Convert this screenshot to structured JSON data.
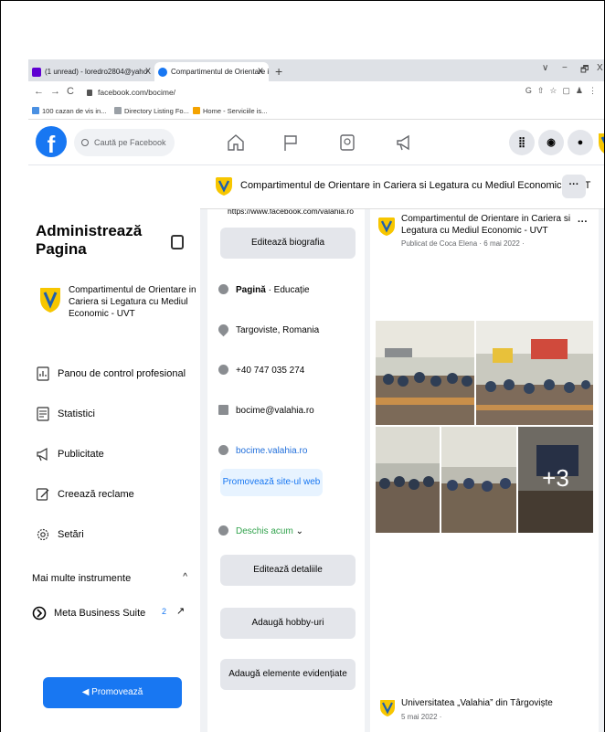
{
  "browser": {
    "tabs": [
      {
        "label": "(1 unread) - loredro2804@yaho",
        "close": "X"
      },
      {
        "label": "Compartimentul de Orientare in",
        "close": "X"
      }
    ],
    "new_tab": "+",
    "window_controls": [
      "∨",
      "−",
      "🗗",
      "X"
    ],
    "url": "facebook.com/bocime/",
    "bookmarks": [
      "100 cazan de vis in...",
      "Directory Listing Fo...",
      "Home - Serviciile is..."
    ]
  },
  "fb": {
    "logo": "f",
    "search_placeholder": "Caută pe Facebook"
  },
  "sidebar": {
    "title": "Administrează Pagina",
    "page_name": "Compartimentul de Orientare in Cariera si Legatura cu Mediul Economic - UVT",
    "items": [
      {
        "label": "Panou de control profesional",
        "icon": "dashboard-icon"
      },
      {
        "label": "Statistici",
        "icon": "insights-icon"
      },
      {
        "label": "Publicitate",
        "icon": "megaphone-icon"
      },
      {
        "label": "Creează reclame",
        "icon": "pencil-icon"
      },
      {
        "label": "Setări",
        "icon": "gear-icon"
      }
    ],
    "more_tools": "Mai multe instrumente",
    "more_tools_caret": "^",
    "meta_suite": "Meta Business Suite",
    "meta_badge": "2",
    "meta_arrow": "↗",
    "promote_button": "Promovează"
  },
  "main": {
    "page_name": "Compartimentul de Orientare in Cariera si Legatura cu Mediul Economic - UVT",
    "dots": "···",
    "intro": {
      "url_cut": "https://www.facebook.com/valahia.ro",
      "edit_bio": "Editează biografia",
      "category_label": "Pagină",
      "category_value": " · Educație",
      "location": "Targoviste, Romania",
      "phone": "+40 747 035 274",
      "email": "bocime@valahia.ro",
      "website": "bocime.valahia.ro",
      "promote_site": "Promovează site-ul web",
      "open_now": "Deschis acum",
      "open_caret": "⌄",
      "edit_details": "Editează detaliile",
      "add_hobbies": "Adaugă hobby-uri",
      "add_featured": "Adaugă elemente evidențiate"
    },
    "post": {
      "author": "Compartimentul de Orientare in Cariera si Legatura cu Mediul Economic - UVT",
      "meta": "Publicat de Coca Elena · 6 mai 2022 ·",
      "dots": "···",
      "more_photos": "+3"
    },
    "post2": {
      "author": "Universitatea „Valahia” din Târgoviște",
      "meta": "5 mai 2022 ·"
    }
  },
  "colors": {
    "fb_blue": "#1877f2",
    "bg": "#f0f2f5"
  }
}
